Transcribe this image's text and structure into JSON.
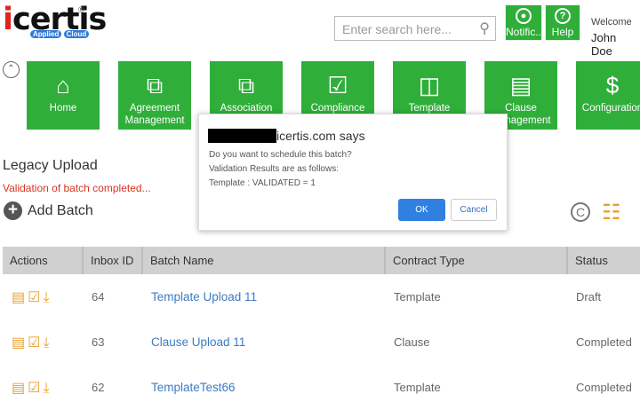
{
  "brand": {
    "name": "icertis",
    "tagline": "Applied",
    "tagline_badge": "Cloud"
  },
  "header": {
    "search_placeholder": "Enter search here...",
    "notifications_label": "Notific...",
    "help_label": "Help",
    "welcome": "Welcome",
    "user_name": "John Doe"
  },
  "tiles": [
    {
      "label": "Home",
      "icon": "home-icon"
    },
    {
      "label": "Agreement Management",
      "icon": "documents-icon"
    },
    {
      "label": "Association",
      "icon": "copy-icon"
    },
    {
      "label": "Compliance",
      "icon": "document-check-icon"
    },
    {
      "label": "Template",
      "icon": "template-icon"
    },
    {
      "label": "Clause Management",
      "icon": "clipboard-icon"
    },
    {
      "label": "Configuration",
      "icon": "document-dollar-icon"
    }
  ],
  "page": {
    "title": "Legacy Upload",
    "status_message": "Validation of batch completed...",
    "add_batch": "Add Batch"
  },
  "table": {
    "columns": [
      "Actions",
      "Inbox ID",
      "Batch Name",
      "Contract Type",
      "Status"
    ],
    "rows": [
      {
        "id": "64",
        "name": "Template Upload 11",
        "type": "Template",
        "status": "Draft"
      },
      {
        "id": "63",
        "name": "Clause Upload 11",
        "type": "Clause",
        "status": "Completed"
      },
      {
        "id": "62",
        "name": "TemplateTest66",
        "type": "Template",
        "status": "Completed"
      }
    ]
  },
  "dialog": {
    "title": "icertis.com says",
    "lines": [
      "Do you want to schedule this batch?",
      "Validation Results are as follows:",
      "Template : VALIDATED = 1"
    ],
    "ok": "OK",
    "cancel": "Cancel"
  },
  "colors": {
    "tile_green": "#2fae3a",
    "action_orange": "#e9a02a",
    "link_blue": "#3d7ac2",
    "error_red": "#d9341f",
    "ok_blue": "#2f80e0"
  }
}
